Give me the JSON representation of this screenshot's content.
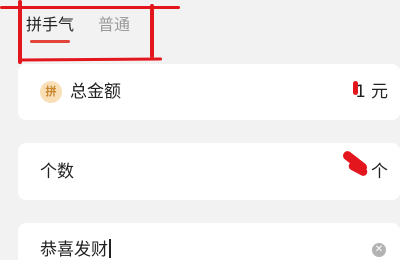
{
  "tabs": [
    {
      "label": "拼手气",
      "active": true
    },
    {
      "label": "普通",
      "active": false
    }
  ],
  "amount_row": {
    "badge": "拼",
    "label": "总金额",
    "value": "1",
    "unit": "元"
  },
  "count_row": {
    "label": "个数",
    "unit": "个"
  },
  "greeting": {
    "value": "恭喜发财"
  },
  "colors": {
    "accent": "#e2433a",
    "annotation": "#e4161d",
    "background": "#f2f2f2",
    "badge_bg": "#f8dfb6",
    "badge_fg": "#c8852e"
  }
}
